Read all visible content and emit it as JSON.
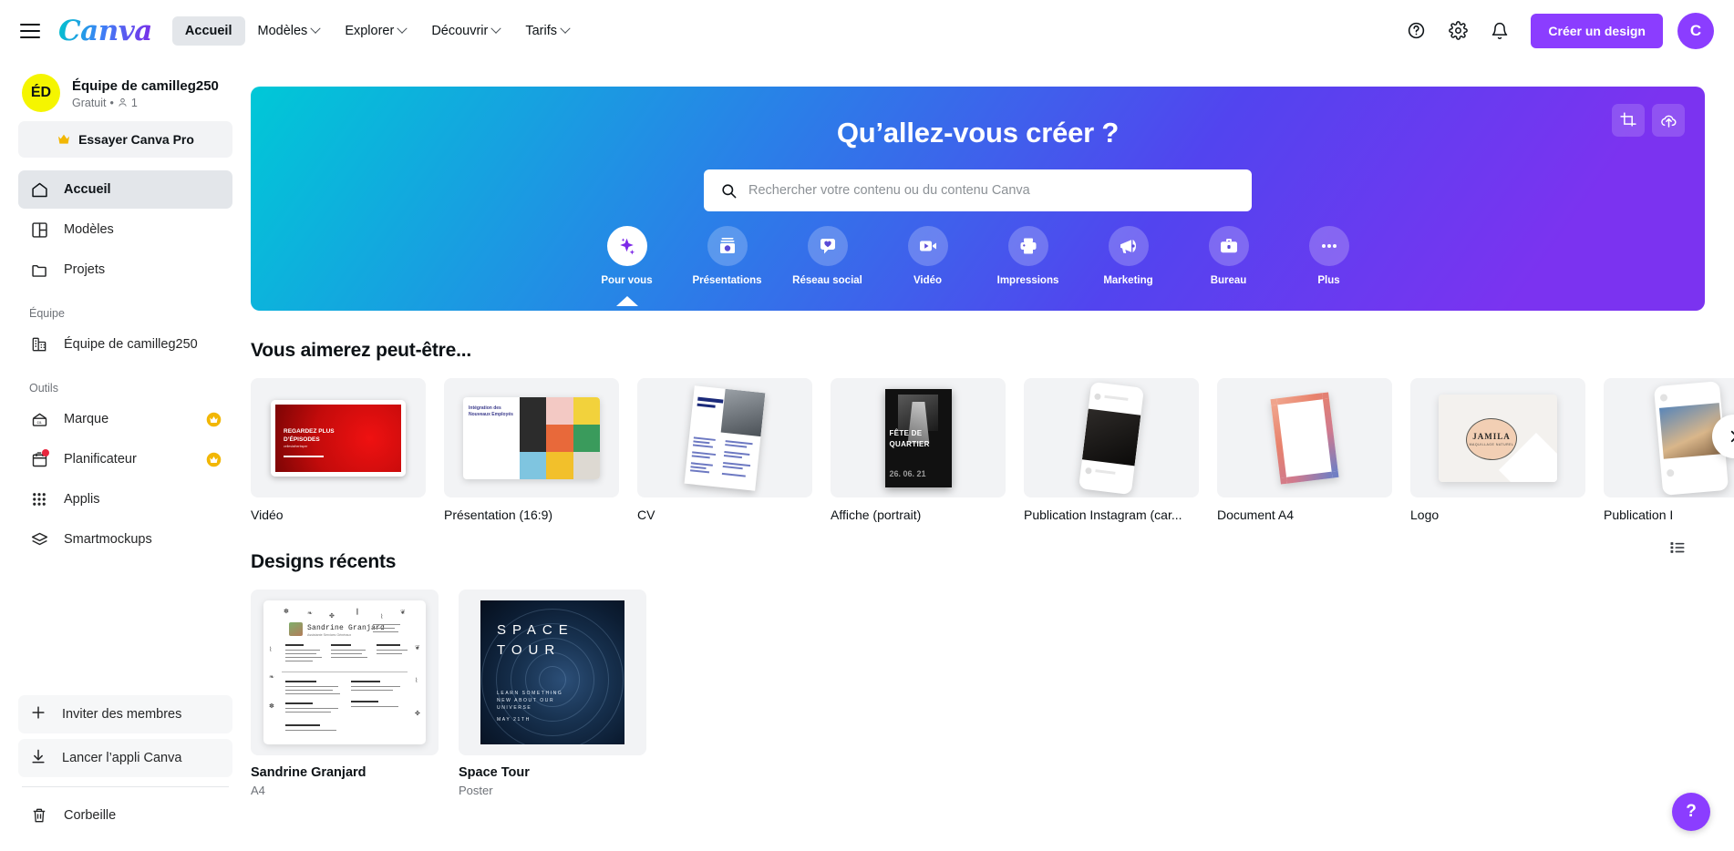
{
  "header": {
    "menu_icon": "hamburger-icon",
    "logo_text": "Canva",
    "nav": [
      {
        "label": "Accueil",
        "has_caret": false,
        "active": true
      },
      {
        "label": "Modèles",
        "has_caret": true,
        "active": false
      },
      {
        "label": "Explorer",
        "has_caret": true,
        "active": false
      },
      {
        "label": "Découvrir",
        "has_caret": true,
        "active": false
      },
      {
        "label": "Tarifs",
        "has_caret": true,
        "active": false
      }
    ],
    "help_icon": "help-circle-icon",
    "settings_icon": "gear-icon",
    "notifications_icon": "bell-icon",
    "create_button": "Créer un design",
    "avatar_initial": "C"
  },
  "sidebar": {
    "team": {
      "initials": "ÉD",
      "name": "Équipe de camilleg250",
      "plan": "Gratuit",
      "separator": "•",
      "members_count": "1"
    },
    "pro_button": "Essayer Canva Pro",
    "main_items": [
      {
        "label": "Accueil",
        "icon": "home-icon",
        "selected": true
      },
      {
        "label": "Modèles",
        "icon": "templates-icon",
        "selected": false
      },
      {
        "label": "Projets",
        "icon": "folder-icon",
        "selected": false
      }
    ],
    "team_section_title": "Équipe",
    "team_items": [
      {
        "label": "Équipe de camilleg250",
        "icon": "building-icon"
      }
    ],
    "tools_section_title": "Outils",
    "tool_items": [
      {
        "label": "Marque",
        "icon": "brand-icon",
        "pro": true,
        "badge": false
      },
      {
        "label": "Planificateur",
        "icon": "calendar-plus-icon",
        "pro": true,
        "badge": true
      },
      {
        "label": "Applis",
        "icon": "apps-grid-icon",
        "pro": false,
        "badge": false
      },
      {
        "label": "Smartmockups",
        "icon": "layers-icon",
        "pro": false,
        "badge": false
      }
    ],
    "bottom_items": [
      {
        "label": "Inviter des membres",
        "icon": "plus-icon"
      },
      {
        "label": "Lancer l’appli Canva",
        "icon": "download-icon"
      }
    ],
    "trash": {
      "label": "Corbeille",
      "icon": "trash-icon"
    }
  },
  "hero": {
    "title": "Qu’allez-vous créer ?",
    "search_placeholder": "Rechercher votre contenu ou du contenu Canva",
    "search_value": "",
    "search_icon": "search-icon",
    "crop_icon": "crop-icon",
    "upload_icon": "cloud-upload-icon",
    "categories": [
      {
        "label": "Pour vous",
        "icon": "sparkle-icon",
        "active": true
      },
      {
        "label": "Présentations",
        "icon": "presentation-icon",
        "active": false
      },
      {
        "label": "Réseau social",
        "icon": "heart-bubble-icon",
        "active": false
      },
      {
        "label": "Vidéo",
        "icon": "video-camera-icon",
        "active": false
      },
      {
        "label": "Impressions",
        "icon": "printer-icon",
        "active": false
      },
      {
        "label": "Marketing",
        "icon": "megaphone-icon",
        "active": false
      },
      {
        "label": "Bureau",
        "icon": "briefcase-icon",
        "active": false
      },
      {
        "label": "Plus",
        "icon": "ellipsis-icon",
        "active": false
      }
    ]
  },
  "suggestions": {
    "title": "Vous aimerez peut-être...",
    "next_icon": "chevron-right-icon",
    "cards": [
      {
        "label": "Vidéo",
        "art": "video"
      },
      {
        "label": "Présentation (16:9)",
        "art": "presentation"
      },
      {
        "label": "CV",
        "art": "cv"
      },
      {
        "label": "Affiche (portrait)",
        "art": "affiche"
      },
      {
        "label": "Publication Instagram (car...",
        "art": "phone"
      },
      {
        "label": "Document A4",
        "art": "a4"
      },
      {
        "label": "Logo",
        "art": "logo"
      },
      {
        "label": "Publication I",
        "art": "phone2"
      }
    ]
  },
  "recent": {
    "title": "Designs récents",
    "list_view_icon": "list-view-icon",
    "designs": [
      {
        "title": "Sandrine Granjard",
        "type": "A4",
        "art": "resume"
      },
      {
        "title": "Space Tour",
        "type": "Poster",
        "art": "space"
      }
    ]
  },
  "thumb_text": {
    "video_line1": "REGARDEZ PLUS",
    "video_line2": "D’ÉPISODES",
    "video_small": "celleslatherbsper",
    "pres_title": "Intégration des Nouveaux Employés",
    "affiche_line1": "FÊTE DE",
    "affiche_line2": "QUARTIER",
    "affiche_date": "26. 06. 21",
    "logo_name": "JAMILA",
    "logo_sub": "MAQUILLAGE NATUREL",
    "resume_name": "Sandrine Granjard",
    "resume_sub": "Assistante Services Généraux",
    "space_line1": "SPACE",
    "space_line2": "TOUR",
    "space_sub": "LEARN SOMETHING NEW ABOUT OUR UNIVERSE",
    "space_date": "MAY 21TH"
  },
  "help_fab": {
    "label": "?"
  },
  "colors": {
    "brand_purple": "#8b3dff",
    "team_avatar_yellow": "#f5f500",
    "hero_gradient_start": "#00c8d7",
    "hero_gradient_end": "#7b33f0",
    "pro_crown": "#f2b705",
    "badge_red": "#e8263e"
  }
}
